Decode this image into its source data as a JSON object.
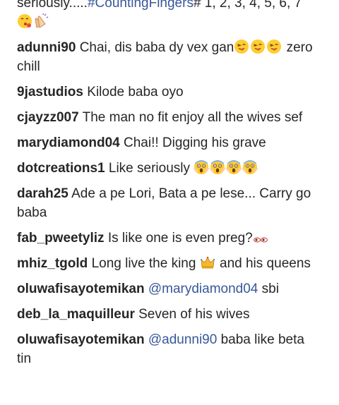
{
  "comments": [
    {
      "id": "c0",
      "user": "",
      "parts": [
        {
          "type": "text",
          "value": "seriously....."
        },
        {
          "type": "hashtag",
          "value": "#CountingFingers"
        },
        {
          "type": "text",
          "value": "# 1, 2, 3, 4, 5, 6, 7 "
        },
        {
          "type": "emoji",
          "icon": "kissing-face-icon"
        },
        {
          "type": "emoji",
          "icon": "clapping-hands-icon"
        }
      ]
    },
    {
      "id": "c1",
      "user": "adunni90",
      "parts": [
        {
          "type": "text",
          "value": "Chai, dis baba dy vex gan"
        },
        {
          "type": "emoji",
          "icon": "tongue-wink-face-icon"
        },
        {
          "type": "emoji",
          "icon": "tongue-wink-face-icon"
        },
        {
          "type": "emoji",
          "icon": "tongue-wink-face-icon"
        },
        {
          "type": "text",
          "value": " zero chill"
        }
      ]
    },
    {
      "id": "c2",
      "user": "9jastudios",
      "parts": [
        {
          "type": "text",
          "value": "Kilode baba oyo"
        }
      ]
    },
    {
      "id": "c3",
      "user": "cjayzz007",
      "parts": [
        {
          "type": "text",
          "value": "The man no fit enjoy all the wives sef"
        }
      ]
    },
    {
      "id": "c4",
      "user": "marydiamond04",
      "parts": [
        {
          "type": "text",
          "value": "Chai!! Digging his grave"
        }
      ]
    },
    {
      "id": "c5",
      "user": "dotcreations1",
      "parts": [
        {
          "type": "text",
          "value": "Like seriously "
        },
        {
          "type": "emoji",
          "icon": "screaming-face-icon"
        },
        {
          "type": "emoji",
          "icon": "screaming-face-icon"
        },
        {
          "type": "emoji",
          "icon": "screaming-face-icon"
        },
        {
          "type": "emoji",
          "icon": "screaming-face-icon"
        }
      ]
    },
    {
      "id": "c6",
      "user": "darah25",
      "parts": [
        {
          "type": "text",
          "value": "Ade a pe Lori, Bata a pe lese... Carry go baba"
        }
      ]
    },
    {
      "id": "c7",
      "user": "fab_pweetyliz",
      "parts": [
        {
          "type": "text",
          "value": "Is like one is even preg?"
        },
        {
          "type": "emoji",
          "icon": "eyes-icon"
        }
      ]
    },
    {
      "id": "c8",
      "user": "mhiz_tgold",
      "parts": [
        {
          "type": "text",
          "value": "Long live the king "
        },
        {
          "type": "emoji",
          "icon": "crown-icon"
        },
        {
          "type": "text",
          "value": " and his queens"
        }
      ]
    },
    {
      "id": "c9",
      "user": "oluwafisayotemikan",
      "parts": [
        {
          "type": "mention",
          "value": "@marydiamond04"
        },
        {
          "type": "text",
          "value": " sbi"
        }
      ]
    },
    {
      "id": "c10",
      "user": "deb_la_maquilleur",
      "parts": [
        {
          "type": "text",
          "value": "Seven of his wives"
        }
      ]
    },
    {
      "id": "c11",
      "user": "oluwafisayotemikan",
      "parts": [
        {
          "type": "mention",
          "value": "@adunni90"
        },
        {
          "type": "text",
          "value": " baba like beta tin"
        }
      ]
    }
  ],
  "colors": {
    "username": "#262626",
    "text": "#262626",
    "link": "#385898",
    "emoji_yellow": "#FFCC33"
  }
}
